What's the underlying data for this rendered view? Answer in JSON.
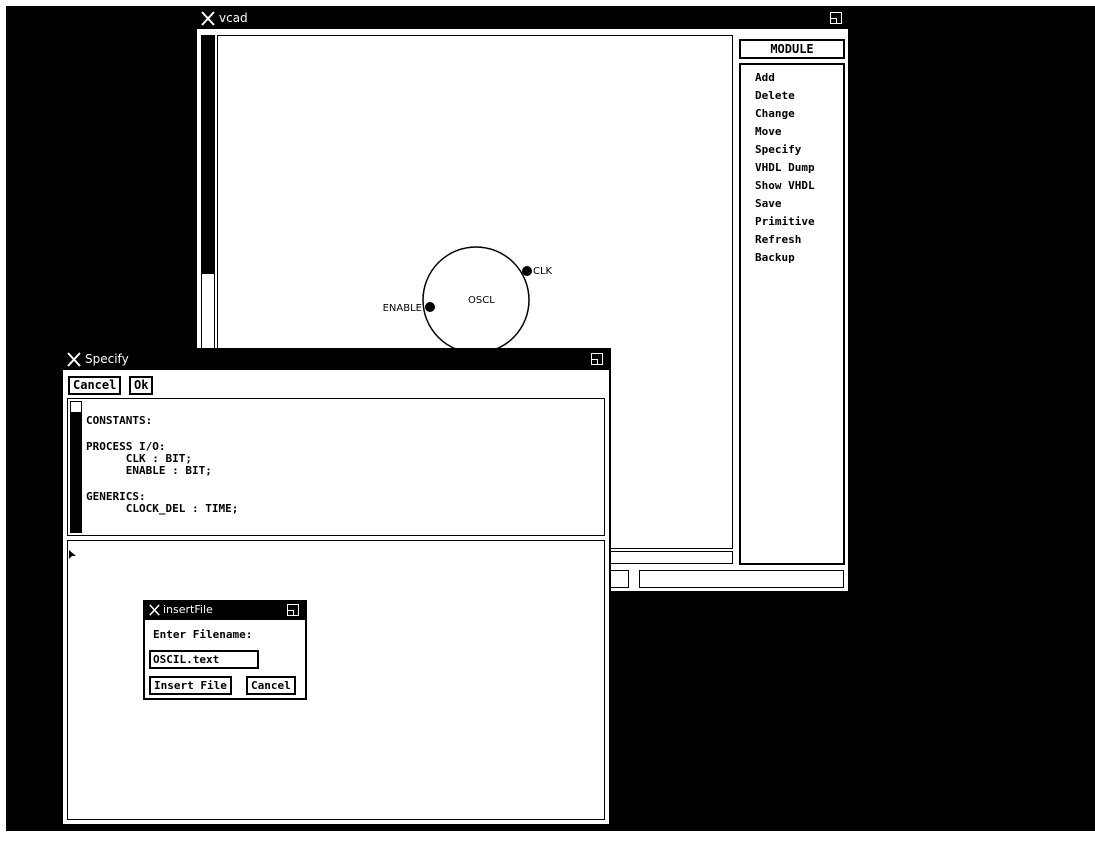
{
  "vcad": {
    "title": "vcad",
    "panel_title": "MODULE",
    "menu": [
      "Add",
      "Delete",
      "Change",
      "Move",
      "Specify",
      "VHDL Dump",
      "Show VHDL",
      "Save",
      "Primitive",
      "Refresh",
      "Backup"
    ],
    "module": {
      "name": "OSCL",
      "ports": [
        "CLK",
        "ENABLE"
      ]
    }
  },
  "specify": {
    "title": "Specify",
    "cancel_label": "Cancel",
    "ok_label": "Ok",
    "lines": [
      "CONSTANTS:",
      "",
      "PROCESS I/O:",
      "      CLK : BIT;",
      "      ENABLE : BIT;",
      "",
      "GENERICS:",
      "      CLOCK_DEL : TIME;"
    ]
  },
  "insert_file": {
    "title": "insertFile",
    "prompt": "Enter Filename:",
    "filename_value": "OSCIL.text",
    "insert_label": "Insert File",
    "cancel_label": "Cancel"
  }
}
